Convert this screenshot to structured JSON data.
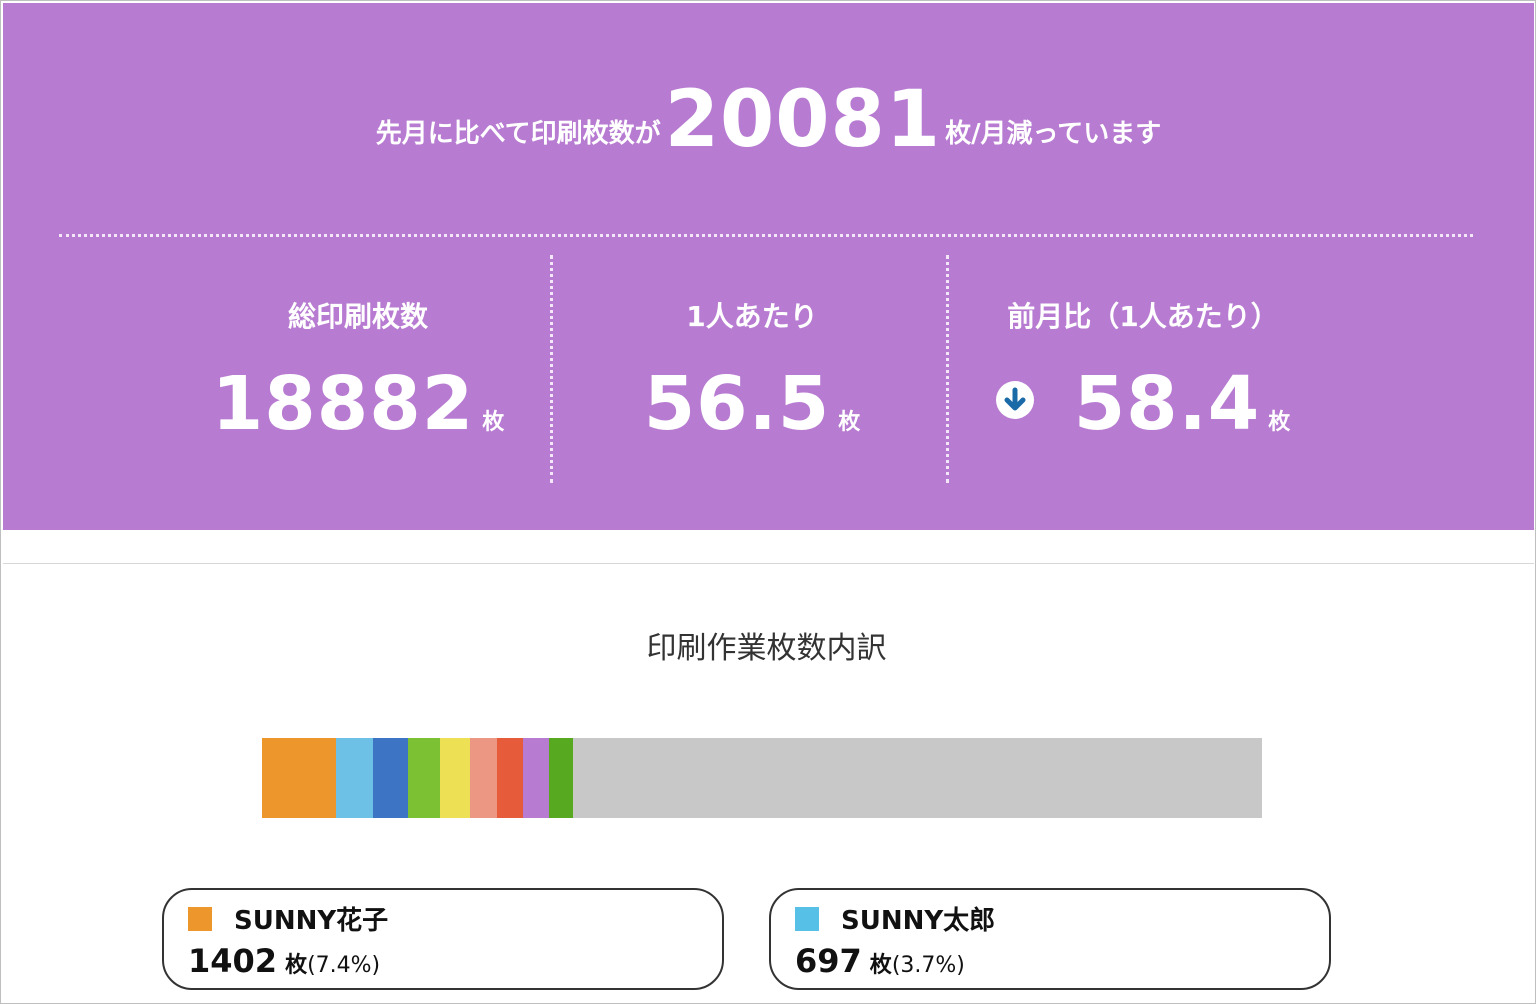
{
  "headline": {
    "prefix": "先月に比べて印刷枚数が",
    "value": "20081",
    "suffix": "枚/月減っています"
  },
  "stats": [
    {
      "label": "総印刷枚数",
      "value": "18882",
      "unit": "枚"
    },
    {
      "label": "1人あたり",
      "value": "56.5",
      "unit": "枚"
    },
    {
      "label": "前月比（1人あたり）",
      "value": "58.4",
      "unit": "枚",
      "icon": "arrow-down-icon"
    }
  ],
  "breakdown": {
    "title": "印刷作業枚数内訳",
    "remainder_color": "#c8c8c8",
    "segments": [
      {
        "percent": 7.4,
        "color": "#ec962b"
      },
      {
        "percent": 3.7,
        "color": "#6ec1e6"
      },
      {
        "percent": 3.5,
        "color": "#3d74c3"
      },
      {
        "percent": 3.2,
        "color": "#7cc034"
      },
      {
        "percent": 3.0,
        "color": "#ede055"
      },
      {
        "percent": 2.7,
        "color": "#ec9784"
      },
      {
        "percent": 2.6,
        "color": "#e65c3b"
      },
      {
        "percent": 2.6,
        "color": "#b77bd1"
      },
      {
        "percent": 2.4,
        "color": "#57aa20"
      }
    ]
  },
  "cards": [
    {
      "name": "SUNNY花子",
      "count": "1402",
      "unit": "枚",
      "percent_text": "(7.4%)",
      "color": "#ec962b"
    },
    {
      "name": "SUNNY太郎",
      "count": "697",
      "unit": "枚",
      "percent_text": "(3.7%)",
      "color": "#56c0e6"
    }
  ],
  "colors": {
    "summary_background": "#b77bd1",
    "icon_arrow": "#1b6aa8"
  }
}
